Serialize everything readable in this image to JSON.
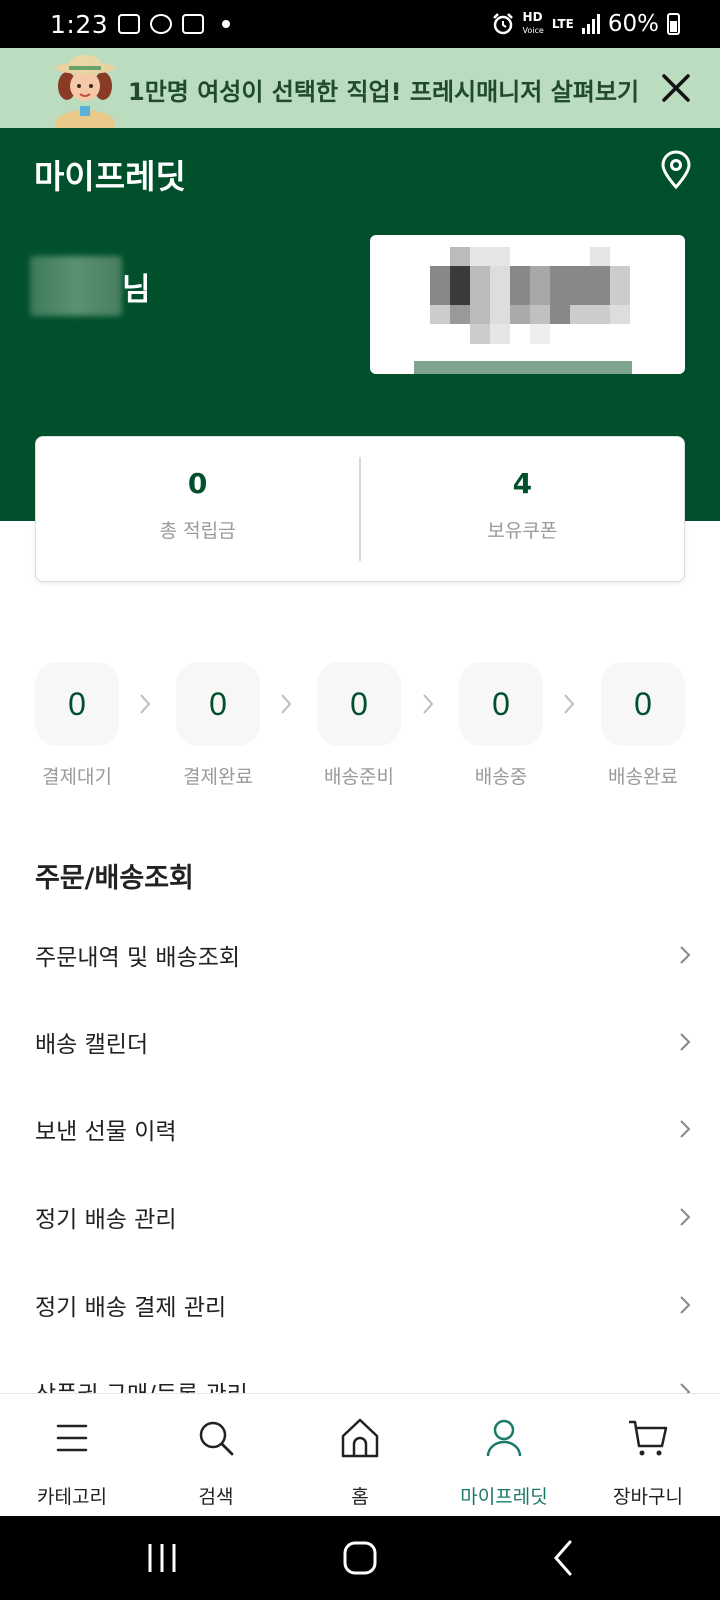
{
  "status_bar": {
    "time": "1:23",
    "hd_top": "HD",
    "hd_bottom": "Voice",
    "lte": "LTE",
    "battery": "60%"
  },
  "promo": {
    "text": "1만명 여성이 선택한 직업! 프레시매니저 살펴보기"
  },
  "header": {
    "title": "마이프레딧",
    "name_suffix": "님"
  },
  "points": {
    "items": [
      {
        "value": "0",
        "label": "총 적립금"
      },
      {
        "value": "4",
        "label": "보유쿠폰"
      }
    ]
  },
  "order_status": {
    "steps": [
      {
        "count": "0",
        "label": "결제대기"
      },
      {
        "count": "0",
        "label": "결제완료"
      },
      {
        "count": "0",
        "label": "배송준비"
      },
      {
        "count": "0",
        "label": "배송중"
      },
      {
        "count": "0",
        "label": "배송완료"
      }
    ]
  },
  "section": {
    "title": "주문/배송조회",
    "items": [
      {
        "label": "주문내역 및 배송조회"
      },
      {
        "label": "배송 캘린더"
      },
      {
        "label": "보낸 선물 이력"
      },
      {
        "label": "정기 배송 관리"
      },
      {
        "label": "정기 배송 결제 관리"
      },
      {
        "label": "상품권 구매/등록 관리"
      }
    ]
  },
  "nav": {
    "items": [
      {
        "label": "카테고리",
        "icon": "menu-icon"
      },
      {
        "label": "검색",
        "icon": "search-icon"
      },
      {
        "label": "홈",
        "icon": "home-icon"
      },
      {
        "label": "마이프레딧",
        "icon": "user-icon"
      },
      {
        "label": "장바구니",
        "icon": "cart-icon"
      }
    ],
    "active_index": 3
  },
  "colors": {
    "brand_green": "#00502c",
    "banner_bg": "#bcdcc0",
    "active_nav": "#1a7a6a"
  }
}
